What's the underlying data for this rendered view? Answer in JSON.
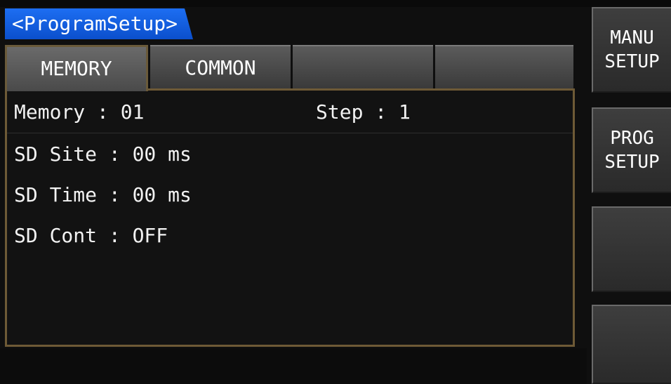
{
  "header": {
    "title": "<ProgramSetup>"
  },
  "tabs": [
    {
      "label": "MEMORY",
      "active": true
    },
    {
      "label": "COMMON",
      "active": false
    },
    {
      "label": "",
      "active": false
    },
    {
      "label": "",
      "active": false
    }
  ],
  "panel": {
    "memory_label": "Memory : 01",
    "step_label": "Step : 1",
    "sd_site": "SD Site : 00 ms",
    "sd_time": "SD Time : 00 ms",
    "sd_cont": "SD Cont : OFF"
  },
  "softkeys": [
    {
      "line1": "MANU",
      "line2": "SETUP"
    },
    {
      "line1": "PROG",
      "line2": "SETUP"
    },
    {
      "line1": "",
      "line2": ""
    },
    {
      "line1": "",
      "line2": ""
    }
  ],
  "colors": {
    "title_bg": "#1d6ef2",
    "panel_border": "#6e5a36",
    "background": "#0f0f0f"
  }
}
